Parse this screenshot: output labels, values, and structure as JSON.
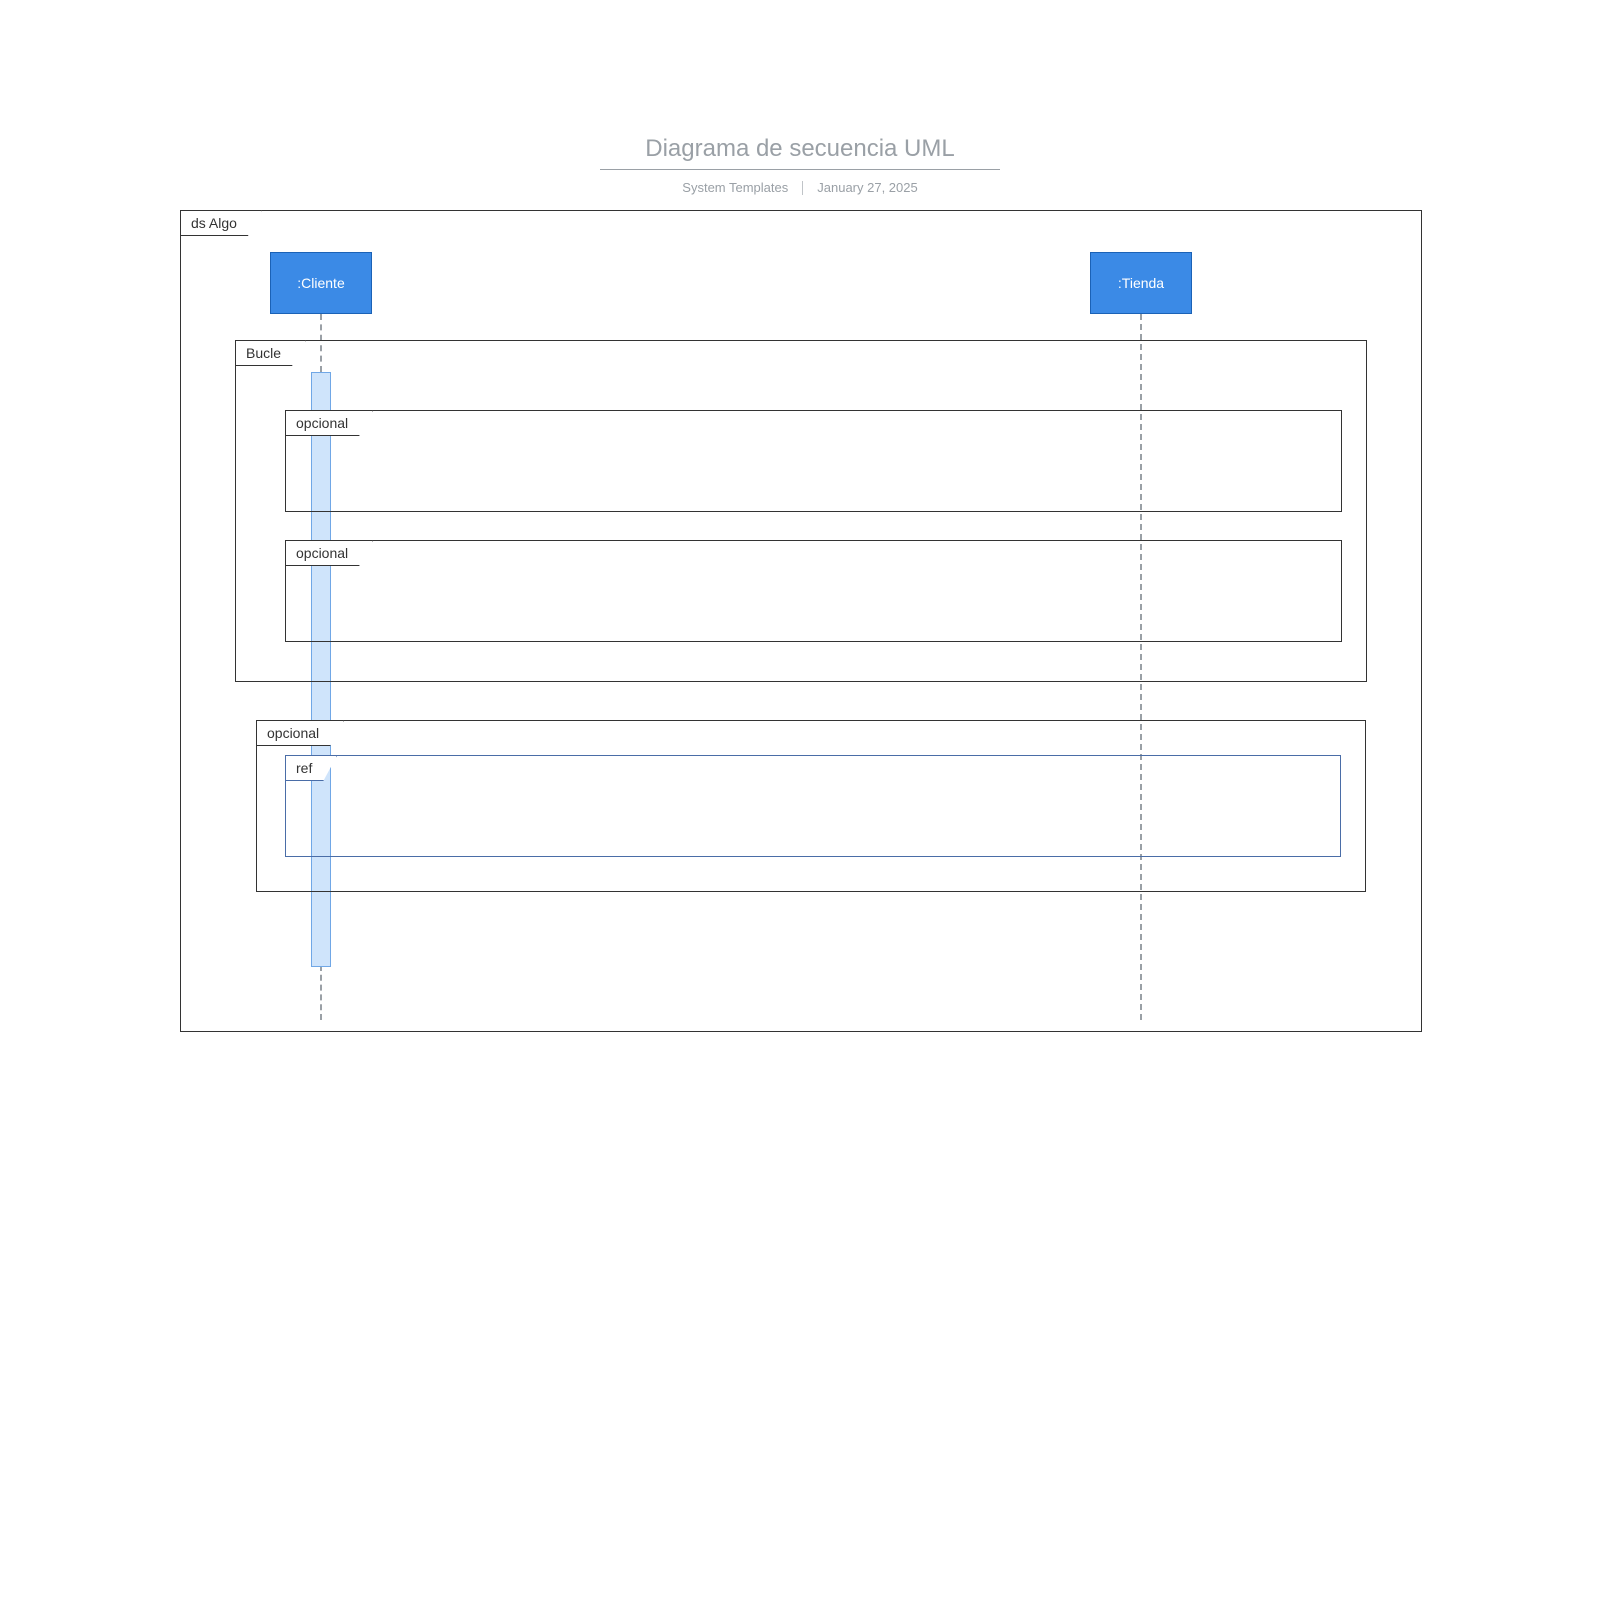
{
  "title": "Diagrama de secuencia UML",
  "subtitle_left": "System Templates",
  "subtitle_right": "January 27, 2025",
  "diagram": {
    "frame_label": "ds Algo",
    "lifelines": [
      {
        "label": ":Cliente"
      },
      {
        "label": ":Tienda"
      }
    ],
    "fragments": {
      "loop": "Bucle",
      "opt1": "opcional",
      "opt2": "opcional",
      "opt3": "opcional",
      "ref": "ref"
    }
  },
  "colors": {
    "accent": "#3b8ae6",
    "muted": "#9aa0a6"
  }
}
